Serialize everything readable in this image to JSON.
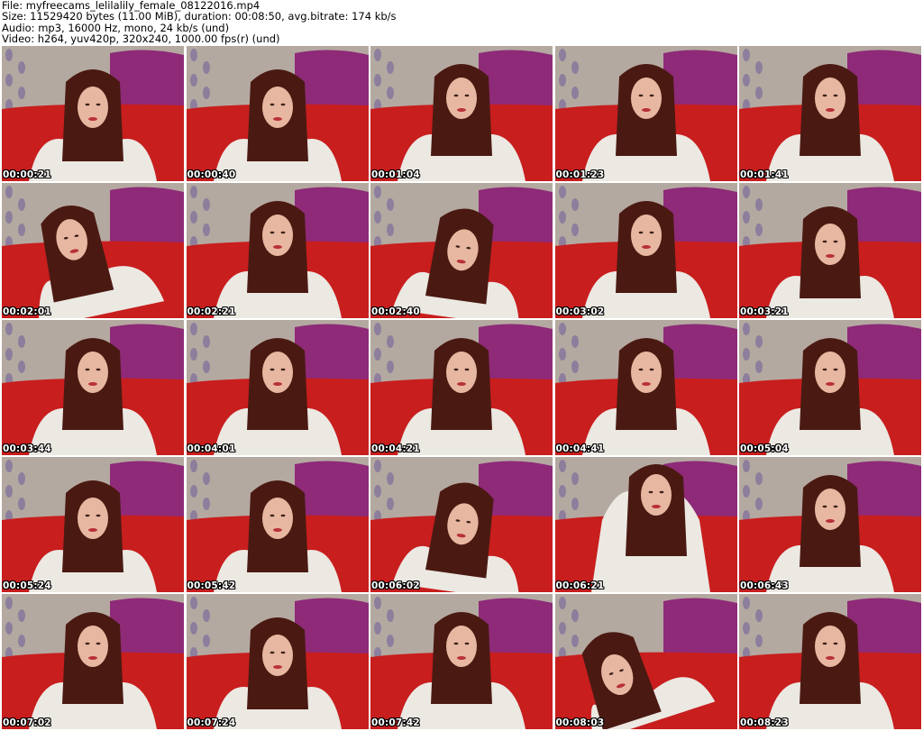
{
  "header": {
    "file_line": "File: myfreecams_lelilalily_female_08122016.mp4",
    "size_line": "Size: 11529420 bytes (11.00 MiB), duration: 00:08:50, avg.bitrate: 174 kb/s",
    "audio_line": "Audio: mp3, 16000 Hz, mono, 24 kb/s (und)",
    "video_line": "Video: h264, yuv420p, 320x240, 1000.00 fps(r) (und)"
  },
  "thumbnails": [
    {
      "timestamp": "00:00:21",
      "pose": "look-down"
    },
    {
      "timestamp": "00:00:40",
      "pose": "look-down"
    },
    {
      "timestamp": "00:01:04",
      "pose": "front"
    },
    {
      "timestamp": "00:01:23",
      "pose": "front"
    },
    {
      "timestamp": "00:01:41",
      "pose": "front"
    },
    {
      "timestamp": "00:02:01",
      "pose": "lean-left"
    },
    {
      "timestamp": "00:02:21",
      "pose": "front"
    },
    {
      "timestamp": "00:02:40",
      "pose": "head-down"
    },
    {
      "timestamp": "00:03:02",
      "pose": "front"
    },
    {
      "timestamp": "00:03:21",
      "pose": "look-down"
    },
    {
      "timestamp": "00:03:44",
      "pose": "front"
    },
    {
      "timestamp": "00:04:01",
      "pose": "front"
    },
    {
      "timestamp": "00:04:21",
      "pose": "front"
    },
    {
      "timestamp": "00:04:41",
      "pose": "front"
    },
    {
      "timestamp": "00:05:04",
      "pose": "front"
    },
    {
      "timestamp": "00:05:24",
      "pose": "look-down"
    },
    {
      "timestamp": "00:05:42",
      "pose": "look-down"
    },
    {
      "timestamp": "00:06:02",
      "pose": "head-down"
    },
    {
      "timestamp": "00:06:21",
      "pose": "arms-up"
    },
    {
      "timestamp": "00:06:43",
      "pose": "front"
    },
    {
      "timestamp": "00:07:02",
      "pose": "front"
    },
    {
      "timestamp": "00:07:24",
      "pose": "look-down"
    },
    {
      "timestamp": "00:07:42",
      "pose": "front"
    },
    {
      "timestamp": "00:08:03",
      "pose": "close-lean"
    },
    {
      "timestamp": "00:08:23",
      "pose": "front"
    }
  ],
  "colors": {
    "page_background": "#ffffff",
    "header_text": "#000000",
    "couch_red": "#c81e1e",
    "pillow_purple": "#8e2a78",
    "wall_floral": "#b4a9a0",
    "hair_brown": "#4a1a12",
    "sweater_white": "#ece8e2",
    "skin": "#e8b7a1",
    "timestamp_text": "#ffffff",
    "timestamp_outline": "#000000"
  }
}
